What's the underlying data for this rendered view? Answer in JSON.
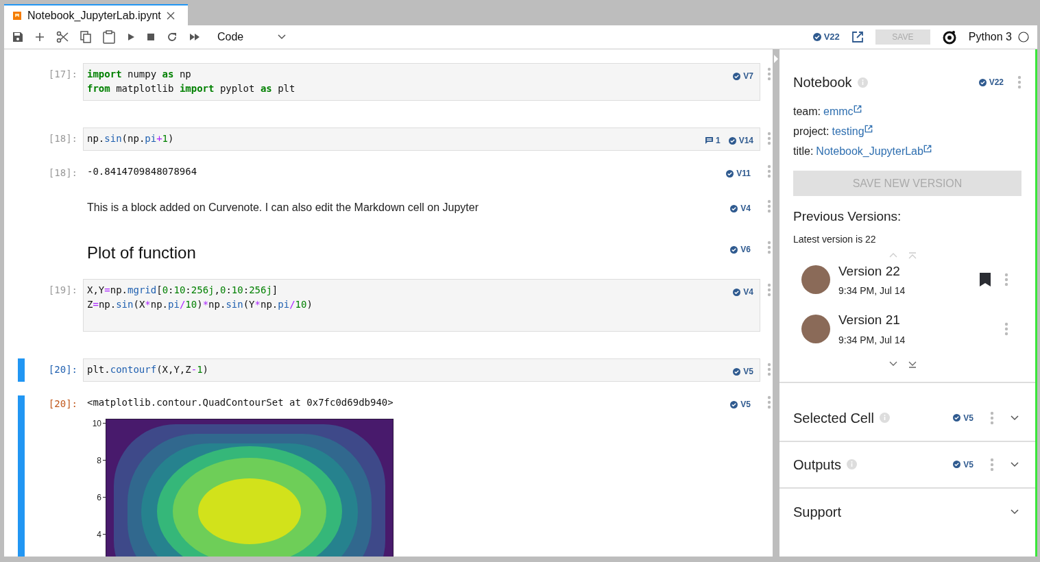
{
  "tab": {
    "title": "Notebook_JupyterLab.ipynt",
    "selected": true
  },
  "toolbar": {
    "cell_type": "Code",
    "version": "V22",
    "save": "SAVE",
    "kernel": "Python 3"
  },
  "cells": [
    {
      "kind": "code",
      "prompt": "[17]:",
      "selected": false,
      "version": "V7",
      "lines": [
        [
          {
            "kind": "keyword",
            "text": "import"
          },
          {
            "kind": "plain",
            "text": " numpy "
          },
          {
            "kind": "keyword",
            "text": "as"
          },
          {
            "kind": "plain",
            "text": " np"
          }
        ],
        [
          {
            "kind": "keyword",
            "text": "from"
          },
          {
            "kind": "plain",
            "text": " matplotlib "
          },
          {
            "kind": "keyword",
            "text": "import"
          },
          {
            "kind": "plain",
            "text": " pyplot "
          },
          {
            "kind": "keyword",
            "text": "as"
          },
          {
            "kind": "plain",
            "text": " plt"
          }
        ]
      ]
    },
    {
      "kind": "code",
      "prompt": "[18]:",
      "selected": false,
      "version": "V14",
      "comments": "1",
      "lines": [
        [
          {
            "kind": "plain",
            "text": "np."
          },
          {
            "kind": "name",
            "text": "sin"
          },
          {
            "kind": "plain",
            "text": "(np."
          },
          {
            "kind": "name",
            "text": "pi"
          },
          {
            "kind": "operator",
            "text": "+"
          },
          {
            "kind": "number",
            "text": "1"
          },
          {
            "kind": "plain",
            "text": ")"
          }
        ]
      ]
    },
    {
      "kind": "output",
      "prompt": "[18]:",
      "selected": false,
      "version": "V11",
      "text": "-0.8414709848078964"
    },
    {
      "kind": "markdown",
      "selected": false,
      "version": "V4",
      "text": "This is a block added on Curvenote. I can also edit the Markdown cell on Jupyter"
    },
    {
      "kind": "heading",
      "selected": false,
      "version": "V6",
      "text": "Plot of function"
    },
    {
      "kind": "code",
      "prompt": "[19]:",
      "selected": false,
      "version": "V4",
      "lines": [
        [
          {
            "kind": "plain",
            "text": "X,Y"
          },
          {
            "kind": "operator",
            "text": "="
          },
          {
            "kind": "plain",
            "text": "np."
          },
          {
            "kind": "name",
            "text": "mgrid"
          },
          {
            "kind": "plain",
            "text": "["
          },
          {
            "kind": "number",
            "text": "0"
          },
          {
            "kind": "plain",
            "text": ":"
          },
          {
            "kind": "number",
            "text": "10"
          },
          {
            "kind": "plain",
            "text": ":"
          },
          {
            "kind": "number",
            "text": "256j"
          },
          {
            "kind": "plain",
            "text": ","
          },
          {
            "kind": "number",
            "text": "0"
          },
          {
            "kind": "plain",
            "text": ":"
          },
          {
            "kind": "number",
            "text": "10"
          },
          {
            "kind": "plain",
            "text": ":"
          },
          {
            "kind": "number",
            "text": "256j"
          },
          {
            "kind": "plain",
            "text": "]"
          }
        ],
        [
          {
            "kind": "plain",
            "text": "Z"
          },
          {
            "kind": "operator",
            "text": "="
          },
          {
            "kind": "plain",
            "text": "np."
          },
          {
            "kind": "name",
            "text": "sin"
          },
          {
            "kind": "plain",
            "text": "(X"
          },
          {
            "kind": "operator",
            "text": "*"
          },
          {
            "kind": "plain",
            "text": "np."
          },
          {
            "kind": "name",
            "text": "pi"
          },
          {
            "kind": "operator",
            "text": "/"
          },
          {
            "kind": "number",
            "text": "10"
          },
          {
            "kind": "plain",
            "text": ")"
          },
          {
            "kind": "operator",
            "text": "*"
          },
          {
            "kind": "plain",
            "text": "np."
          },
          {
            "kind": "name",
            "text": "sin"
          },
          {
            "kind": "plain",
            "text": "(Y"
          },
          {
            "kind": "operator",
            "text": "*"
          },
          {
            "kind": "plain",
            "text": "np."
          },
          {
            "kind": "name",
            "text": "pi"
          },
          {
            "kind": "operator",
            "text": "/"
          },
          {
            "kind": "number",
            "text": "10"
          },
          {
            "kind": "plain",
            "text": ")"
          }
        ]
      ]
    },
    {
      "kind": "code",
      "prompt": "[20]:",
      "selected": true,
      "version": "V5",
      "lines": [
        [
          {
            "kind": "plain",
            "text": "plt."
          },
          {
            "kind": "name",
            "text": "contourf"
          },
          {
            "kind": "plain",
            "text": "(X,Y,Z"
          },
          {
            "kind": "operator",
            "text": "-"
          },
          {
            "kind": "number",
            "text": "1"
          },
          {
            "kind": "plain",
            "text": ")"
          }
        ]
      ]
    },
    {
      "kind": "output",
      "prompt": "[20]:",
      "selected": true,
      "version": "V5",
      "text": "<matplotlib.contour.QuadContourSet at 0x7fc0d69db940>",
      "plot": {
        "ytick_labels": [
          "10",
          "8",
          "6",
          "4"
        ]
      }
    }
  ],
  "panel": {
    "title": "Notebook",
    "version": "V22",
    "links": [
      {
        "label": "team:",
        "value": "emmc"
      },
      {
        "label": "project:",
        "value": "testing"
      },
      {
        "label": "title:",
        "value": "Notebook_JupyterLab"
      }
    ],
    "save_button": {
      "label": "SAVE NEW VERSION",
      "disabled": true
    },
    "previous_title": "Previous Versions:",
    "latest": "Latest version is 22",
    "versions": [
      {
        "name": "Version 22",
        "time": "9:34 PM, Jul 14",
        "bookmarked": true
      },
      {
        "name": "Version 21",
        "time": "9:34 PM, Jul 14",
        "bookmarked": false
      }
    ],
    "sections": [
      {
        "title": "Selected Cell",
        "info": true,
        "version": "V5",
        "expanded": false
      },
      {
        "title": "Outputs",
        "info": true,
        "version": "V5",
        "expanded": false
      },
      {
        "title": "Support",
        "info": false,
        "expanded": false
      }
    ]
  }
}
